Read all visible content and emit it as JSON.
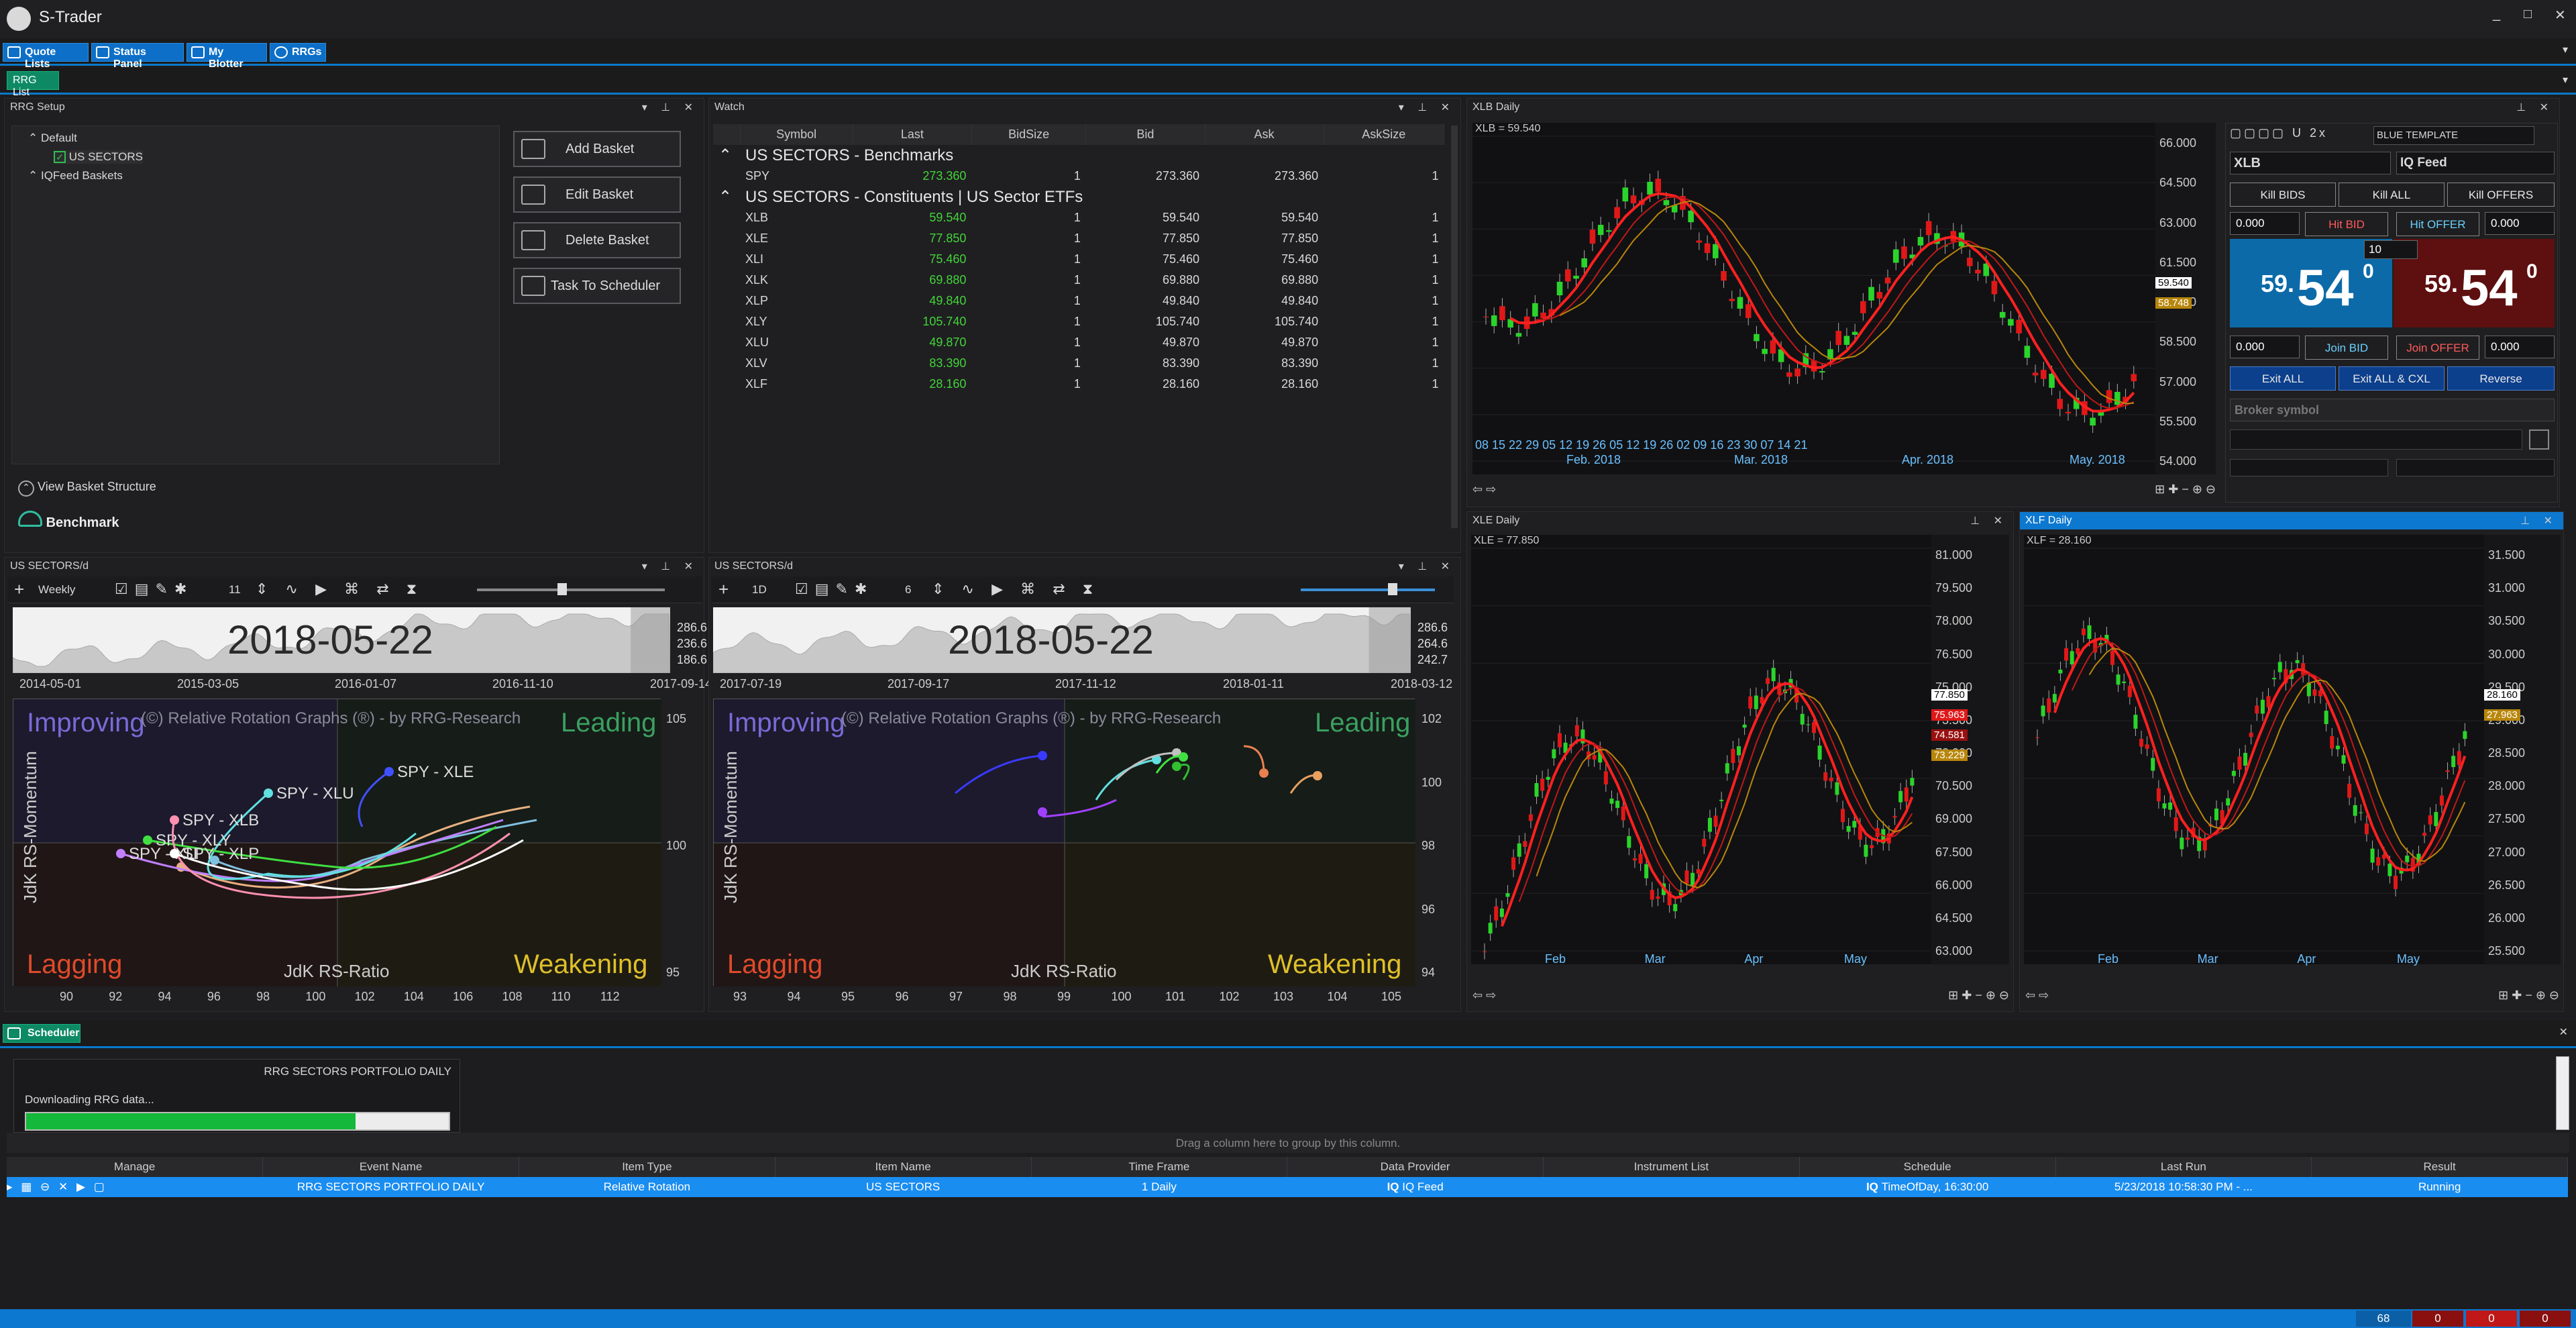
{
  "app": {
    "title": "S-Trader",
    "window_controls": [
      "_",
      "□",
      "✕"
    ]
  },
  "toolbar": {
    "items": [
      {
        "label": "Quote Lists",
        "icon": "grid-icon"
      },
      {
        "label": "Status Panel",
        "icon": "monitor-icon"
      },
      {
        "label": "My Blotter",
        "icon": "monitor-icon"
      },
      {
        "label": "RRGs",
        "icon": "rrg-icon"
      }
    ]
  },
  "subtoolbar": {
    "tab": "RRG List"
  },
  "rrg_setup": {
    "title": "RRG Setup",
    "tree": [
      {
        "label": "Default"
      },
      {
        "label": "US SECTORS",
        "checked": true
      },
      {
        "label": "IQFeed Baskets"
      }
    ],
    "buttons": [
      "Add Basket",
      "Edit Basket",
      "Delete Basket",
      "Task To Scheduler"
    ],
    "view_structure": "View Basket Structure",
    "benchmark": "Benchmark"
  },
  "watch": {
    "title": "Watch",
    "columns": [
      "Symbol",
      "Last",
      "BidSize",
      "Bid",
      "Ask",
      "AskSize"
    ],
    "group1": "US SECTORS - Benchmarks",
    "group1_rows": [
      [
        "SPY",
        "273.360",
        "1",
        "273.360",
        "273.360",
        "1"
      ]
    ],
    "group2": "US SECTORS - Constituents | US Sector ETFs",
    "group2_rows": [
      [
        "XLB",
        "59.540",
        "1",
        "59.540",
        "59.540",
        "1"
      ],
      [
        "XLE",
        "77.850",
        "1",
        "77.850",
        "77.850",
        "1"
      ],
      [
        "XLI",
        "75.460",
        "1",
        "75.460",
        "75.460",
        "1"
      ],
      [
        "XLK",
        "69.880",
        "1",
        "69.880",
        "69.880",
        "1"
      ],
      [
        "XLP",
        "49.840",
        "1",
        "49.840",
        "49.840",
        "1"
      ],
      [
        "XLY",
        "105.740",
        "1",
        "105.740",
        "105.740",
        "1"
      ],
      [
        "XLU",
        "49.870",
        "1",
        "49.870",
        "49.870",
        "1"
      ],
      [
        "XLV",
        "83.390",
        "1",
        "83.390",
        "83.390",
        "1"
      ],
      [
        "XLF",
        "28.160",
        "1",
        "28.160",
        "28.160",
        "1"
      ]
    ]
  },
  "rrg_left": {
    "title": "US SECTORS/d",
    "period": "Weekly",
    "tail": "11",
    "date": "2018-05-22",
    "spark_labels": [
      "2014-05-01",
      "2015-03-05",
      "2016-01-07",
      "2016-11-10",
      "2017-09-14"
    ],
    "spark_right": [
      "286.6",
      "236.6",
      "186.6"
    ],
    "watermark": "(©) Relative Rotation Graphs (®) - by RRG-Research",
    "quadrants": {
      "improving": "Improving",
      "leading": "Leading",
      "lagging": "Lagging",
      "weakening": "Weakening"
    },
    "ylabel": "JdK RS-Momentum",
    "xlabel": "JdK RS-Ratio",
    "xticks": [
      "90",
      "92",
      "94",
      "96",
      "98",
      "100",
      "102",
      "104",
      "106",
      "108",
      "110",
      "112"
    ],
    "yticks": [
      "105",
      "100",
      "95"
    ],
    "labels": [
      "SPY - XLE",
      "SPY - XLU",
      "SPY - XLP",
      "SPY - XLB",
      "SPY - XLI",
      "SPY - XLY"
    ]
  },
  "rrg_right": {
    "title": "US SECTORS/d",
    "period": "1D",
    "tail": "6",
    "date": "2018-05-22",
    "spark_labels": [
      "2017-07-19",
      "2017-09-17",
      "2017-11-12",
      "2018-01-11",
      "2018-03-12"
    ],
    "spark_right": [
      "286.6",
      "264.6",
      "242.7"
    ],
    "watermark": "(©) Relative Rotation Graphs (®) - by RRG-Research",
    "quadrants": {
      "improving": "Improving",
      "leading": "Leading",
      "lagging": "Lagging",
      "weakening": "Weakening"
    },
    "ylabel": "JdK RS-Momentum",
    "xlabel": "JdK RS-Ratio",
    "xticks": [
      "93",
      "94",
      "95",
      "96",
      "97",
      "98",
      "99",
      "100",
      "101",
      "102",
      "103",
      "104",
      "105"
    ],
    "yticks": [
      "102",
      "100",
      "98",
      "96",
      "94"
    ]
  },
  "xlb_chart": {
    "title": "XLB Daily",
    "legend": "XLB = 59.540",
    "yticks": [
      "66.000",
      "64.500",
      "63.000",
      "61.500",
      "60.000",
      "58.500",
      "57.000",
      "55.500",
      "54.000"
    ],
    "price_tags": [
      "59.540",
      "58.748"
    ],
    "xdays": "08 15 22 29 05 12 19 26 05 12 19 26 02 09 16 23 30 07 14 21",
    "xmonths": [
      "Feb. 2018",
      "Mar. 2018",
      "Apr. 2018",
      "May. 2018"
    ]
  },
  "order_ticket": {
    "template": "BLUE TEMPLATE",
    "symbol": "XLB",
    "feed": "IQ Feed",
    "kill": [
      "Kill BIDS",
      "Kill ALL",
      "Kill OFFERS"
    ],
    "bid_qty": "0.000",
    "hit_bid": "Hit BID",
    "hit_offer": "Hit OFFER",
    "offer_qty": "0.000",
    "size": "10",
    "bid_big": "54",
    "bid_small": "59.",
    "bid_sup": "0",
    "ask_big": "54",
    "ask_small": "59.",
    "ask_sup": "0",
    "join_bid": "Join BID",
    "join_offer": "Join OFFER",
    "exit": [
      "Exit ALL",
      "Exit ALL & CXL",
      "Reverse"
    ],
    "broker_symbol": "Broker symbol"
  },
  "xle_chart": {
    "title": "XLE Daily",
    "legend": "XLE = 77.850",
    "yticks": [
      "81.000",
      "79.500",
      "78.000",
      "76.500",
      "75.000",
      "73.500",
      "72.000",
      "70.500",
      "69.000",
      "67.500",
      "66.000",
      "64.500",
      "63.000"
    ],
    "price_tags": [
      "77.850",
      "75.963",
      "74.581",
      "73.229"
    ],
    "xmonths": [
      "Feb",
      "Mar",
      "Apr",
      "May"
    ]
  },
  "xlf_chart": {
    "title": "XLF Daily",
    "legend": "XLF = 28.160",
    "yticks": [
      "31.500",
      "31.000",
      "30.500",
      "30.000",
      "29.500",
      "29.000",
      "28.500",
      "28.000",
      "27.500",
      "27.000",
      "26.500",
      "26.000",
      "25.500"
    ],
    "price_tags": [
      "28.160",
      "27.963"
    ],
    "xmonths": [
      "Feb",
      "Mar",
      "Apr",
      "May"
    ]
  },
  "scheduler": {
    "title": "Scheduler",
    "task": "RRG SECTORS PORTFOLIO DAILY",
    "status": "Downloading RRG data...",
    "progress": 0.78,
    "group_hint": "Drag a column here to group by this column.",
    "columns": [
      "Manage",
      "Event Name",
      "Item Type",
      "Item Name",
      "Time Frame",
      "Data Provider",
      "Instrument List",
      "Schedule",
      "Last Run",
      "Result"
    ],
    "row": [
      "",
      "RRG SECTORS PORTFOLIO DAILY",
      "Relative Rotation",
      "US SECTORS",
      "1 Daily",
      "IQ Feed",
      "",
      "TimeOfDay, 16:30:00",
      "5/23/2018 10:58:30 PM - ...",
      "Running"
    ]
  },
  "statusbar": {
    "values": [
      "68",
      "0",
      "0",
      "0"
    ]
  }
}
